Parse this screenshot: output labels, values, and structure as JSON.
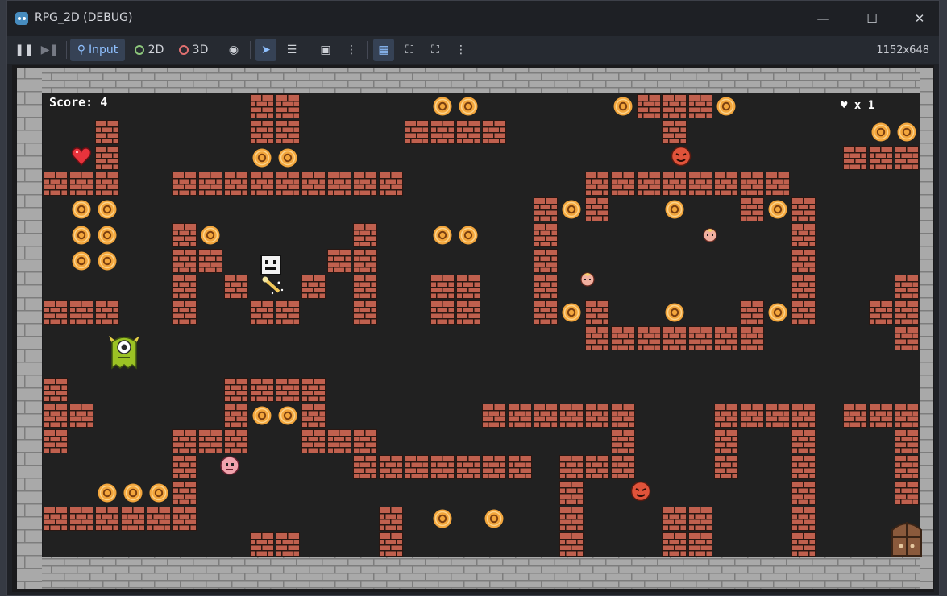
{
  "window": {
    "title": "RPG_2D (DEBUG)",
    "minimize_icon": "minimize-icon",
    "maximize_icon": "maximize-icon",
    "close_icon": "close-icon"
  },
  "toolbar": {
    "input_label": "Input",
    "mode_2d_label": "2D",
    "mode_3d_label": "3D",
    "resolution": "1152x648",
    "mode_2d_color": "#8dc77b",
    "mode_3d_color": "#e07070"
  },
  "game": {
    "score_label": "Score: 4",
    "lives_label": "♥ x 1",
    "colors": {
      "wall": "#a9a9a9",
      "floor": "#212121",
      "brick": "#c0604e",
      "coin": "#f3a63c"
    }
  }
}
